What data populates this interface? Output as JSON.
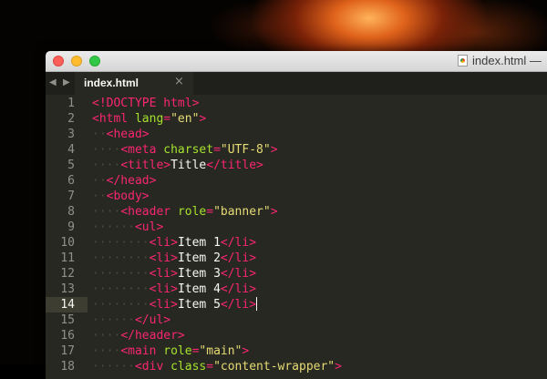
{
  "window": {
    "title": "index.html —",
    "file_icon": "html-file-icon",
    "colors": {
      "background": "#272822",
      "tag": "#f92672",
      "attribute": "#a6e22e",
      "string": "#e6db74",
      "text": "#f8f8f2",
      "line_number": "#90908a"
    }
  },
  "tabs": [
    {
      "label": "index.html",
      "close": "×",
      "active": true
    }
  ],
  "nav": {
    "back": "◀",
    "forward": "▶"
  },
  "editor": {
    "active_line": 14,
    "line_numbers": [
      "1",
      "2",
      "3",
      "4",
      "5",
      "6",
      "7",
      "8",
      "9",
      "10",
      "11",
      "12",
      "13",
      "14",
      "15",
      "16",
      "17",
      "18"
    ],
    "lines": [
      {
        "ws": "",
        "tokens": [
          {
            "c": "tag",
            "t": "<!DOCTYPE html>"
          }
        ]
      },
      {
        "ws": "",
        "tokens": [
          {
            "c": "tag",
            "t": "<html "
          },
          {
            "c": "attr",
            "t": "lang"
          },
          {
            "c": "tag",
            "t": "="
          },
          {
            "c": "str",
            "t": "\"en\""
          },
          {
            "c": "tag",
            "t": ">"
          }
        ]
      },
      {
        "ws": "··",
        "tokens": [
          {
            "c": "tag",
            "t": "<head>"
          }
        ]
      },
      {
        "ws": "····",
        "tokens": [
          {
            "c": "tag",
            "t": "<meta "
          },
          {
            "c": "attr",
            "t": "charset"
          },
          {
            "c": "tag",
            "t": "="
          },
          {
            "c": "str",
            "t": "\"UTF-8\""
          },
          {
            "c": "tag",
            "t": ">"
          }
        ]
      },
      {
        "ws": "····",
        "tokens": [
          {
            "c": "tag",
            "t": "<title>"
          },
          {
            "c": "txt",
            "t": "Title"
          },
          {
            "c": "tag",
            "t": "</title>"
          }
        ]
      },
      {
        "ws": "··",
        "tokens": [
          {
            "c": "tag",
            "t": "</head>"
          }
        ]
      },
      {
        "ws": "··",
        "tokens": [
          {
            "c": "tag",
            "t": "<body>"
          }
        ]
      },
      {
        "ws": "····",
        "tokens": [
          {
            "c": "tag",
            "t": "<header "
          },
          {
            "c": "attr",
            "t": "role"
          },
          {
            "c": "tag",
            "t": "="
          },
          {
            "c": "str",
            "t": "\"banner\""
          },
          {
            "c": "tag",
            "t": ">"
          }
        ]
      },
      {
        "ws": "······",
        "tokens": [
          {
            "c": "tag",
            "t": "<ul>"
          }
        ]
      },
      {
        "ws": "········",
        "tokens": [
          {
            "c": "tag",
            "t": "<li>"
          },
          {
            "c": "txt",
            "t": "Item 1"
          },
          {
            "c": "tag",
            "t": "</li>"
          }
        ]
      },
      {
        "ws": "········",
        "tokens": [
          {
            "c": "tag",
            "t": "<li>"
          },
          {
            "c": "txt",
            "t": "Item 2"
          },
          {
            "c": "tag",
            "t": "</li>"
          }
        ]
      },
      {
        "ws": "········",
        "tokens": [
          {
            "c": "tag",
            "t": "<li>"
          },
          {
            "c": "txt",
            "t": "Item 3"
          },
          {
            "c": "tag",
            "t": "</li>"
          }
        ]
      },
      {
        "ws": "········",
        "tokens": [
          {
            "c": "tag",
            "t": "<li>"
          },
          {
            "c": "txt",
            "t": "Item 4"
          },
          {
            "c": "tag",
            "t": "</li>"
          }
        ]
      },
      {
        "ws": "········",
        "tokens": [
          {
            "c": "tag",
            "t": "<li>"
          },
          {
            "c": "txt",
            "t": "Item 5"
          },
          {
            "c": "tag",
            "t": "</li>"
          }
        ],
        "caret": true
      },
      {
        "ws": "······",
        "tokens": [
          {
            "c": "tag",
            "t": "</ul>"
          }
        ]
      },
      {
        "ws": "····",
        "tokens": [
          {
            "c": "tag",
            "t": "</header>"
          }
        ]
      },
      {
        "ws": "····",
        "tokens": [
          {
            "c": "tag",
            "t": "<main "
          },
          {
            "c": "attr",
            "t": "role"
          },
          {
            "c": "tag",
            "t": "="
          },
          {
            "c": "str",
            "t": "\"main\""
          },
          {
            "c": "tag",
            "t": ">"
          }
        ]
      },
      {
        "ws": "······",
        "tokens": [
          {
            "c": "tag",
            "t": "<div "
          },
          {
            "c": "attr",
            "t": "class"
          },
          {
            "c": "tag",
            "t": "="
          },
          {
            "c": "str",
            "t": "\"content-wrapper\""
          },
          {
            "c": "tag",
            "t": ">"
          }
        ]
      }
    ]
  }
}
